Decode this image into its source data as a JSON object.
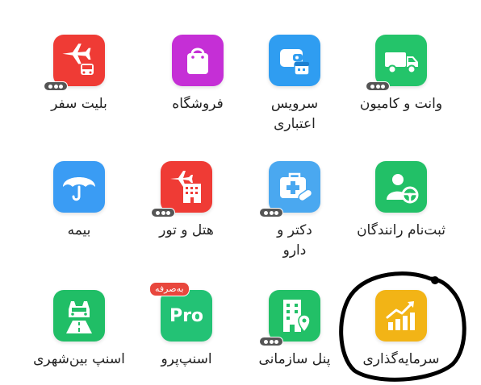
{
  "tiles": [
    {
      "key": "flight",
      "label": "بلیت سفر",
      "icon": "airplane-bus-icon",
      "color": "#ef3b35",
      "dots": true
    },
    {
      "key": "shop",
      "label": "فروشگاه",
      "icon": "shopping-bag-icon",
      "color": "#c52fd6",
      "dots": false
    },
    {
      "key": "credit",
      "label": "سرویس\nاعتباری",
      "icon": "wallet-calendar-icon",
      "color": "#2f9df1",
      "dots": false
    },
    {
      "key": "truck",
      "label": "وانت و کامیون",
      "icon": "truck-icon",
      "color": "#24c46a",
      "dots": true
    },
    {
      "key": "insurance",
      "label": "بیمه",
      "icon": "umbrella-icon",
      "color": "#3a9cf4",
      "dots": false
    },
    {
      "key": "hotel",
      "label": "هتل و تور",
      "icon": "hotel-plane-icon",
      "color": "#ef3b35",
      "dots": true
    },
    {
      "key": "doctor",
      "label": "دکتر و\nدارو",
      "icon": "medical-kit-icon",
      "color": "#4aa8f0",
      "dots": true
    },
    {
      "key": "driver",
      "label": "ثبت‌نام رانندگان",
      "icon": "driver-wheel-icon",
      "color": "#22c067",
      "dots": false
    },
    {
      "key": "intercity",
      "label": "اسنپ بین‌شهری",
      "icon": "car-road-icon",
      "color": "#20be66",
      "dots": false
    },
    {
      "key": "snappro",
      "label": "اسنپ‌پرو",
      "icon": "pro-icon",
      "color": "#23c275",
      "dots": false,
      "badge": "به‌صرفه",
      "icon_text": "Pro"
    },
    {
      "key": "panel",
      "label": "پنل سازمانی",
      "icon": "building-pin-icon",
      "color": "#22c067",
      "dots": true
    },
    {
      "key": "invest",
      "label": "سرمایه‌گذاری",
      "icon": "chart-up-icon",
      "color": "#f2b416",
      "dots": false
    }
  ]
}
